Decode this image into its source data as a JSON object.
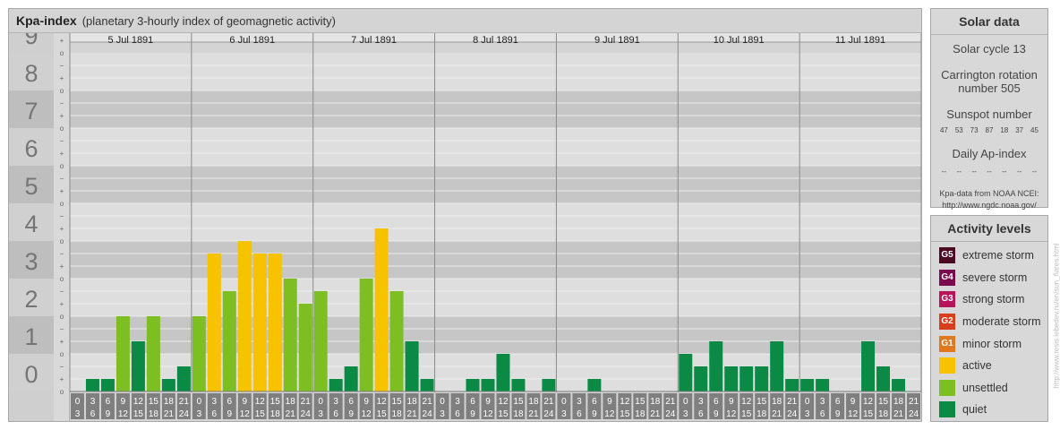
{
  "title": {
    "main": "Kpa-index",
    "subtitle": "(planetary 3-hourly index of geomagnetic activity)"
  },
  "chart_data": {
    "type": "bar",
    "title": "Kpa-index",
    "subtitle": "(planetary 3-hourly index of geomagnetic activity)",
    "ylim": [
      0,
      9
    ],
    "y_ticks": [
      "0",
      "1",
      "2",
      "3",
      "4",
      "5",
      "6",
      "7",
      "8",
      "9"
    ],
    "sub_ticks": [
      "+",
      "o",
      "−"
    ],
    "days": [
      "5 Jul 1891",
      "6 Jul 1891",
      "7 Jul 1891",
      "8 Jul 1891",
      "9 Jul 1891",
      "10 Jul 1891",
      "11 Jul 1891"
    ],
    "interval_starts": [
      "0",
      "3",
      "6",
      "9",
      "12",
      "15",
      "18",
      "21"
    ],
    "interval_ends": [
      "3",
      "6",
      "9",
      "12",
      "15",
      "18",
      "21",
      "24"
    ],
    "values": [
      [
        0,
        0.333,
        0.333,
        2,
        1.333,
        2,
        0.333,
        0.667
      ],
      [
        2,
        3.667,
        2.667,
        4,
        3.667,
        3.667,
        3,
        2.333
      ],
      [
        2.667,
        0.333,
        0.667,
        3,
        4.333,
        2.667,
        1.333,
        0.333
      ],
      [
        0,
        0,
        0.333,
        0.333,
        1,
        0.333,
        0,
        0.333
      ],
      [
        0,
        0,
        0.333,
        0,
        0,
        0,
        0,
        0
      ],
      [
        1,
        0.667,
        1.333,
        0.667,
        0.667,
        0.667,
        1.333,
        0.333
      ],
      [
        0.333,
        0.333,
        0,
        0,
        1.333,
        0.667,
        0.333,
        0
      ]
    ],
    "bar_colors": [
      [
        "quiet",
        "quiet",
        "quiet",
        "unsettled",
        "quiet",
        "unsettled",
        "quiet",
        "quiet"
      ],
      [
        "unsettled",
        "active",
        "unsettled",
        "active",
        "active",
        "active",
        "unsettled",
        "unsettled"
      ],
      [
        "unsettled",
        "quiet",
        "quiet",
        "unsettled",
        "active",
        "unsettled",
        "quiet",
        "quiet"
      ],
      [
        "quiet",
        "quiet",
        "quiet",
        "quiet",
        "quiet",
        "quiet",
        "quiet",
        "quiet"
      ],
      [
        "quiet",
        "quiet",
        "quiet",
        "quiet",
        "quiet",
        "quiet",
        "quiet",
        "quiet"
      ],
      [
        "quiet",
        "quiet",
        "quiet",
        "quiet",
        "quiet",
        "quiet",
        "quiet",
        "quiet"
      ],
      [
        "quiet",
        "quiet",
        "quiet",
        "quiet",
        "quiet",
        "quiet",
        "quiet",
        "quiet"
      ]
    ],
    "colors": {
      "quiet": "#0a8a45",
      "unsettled": "#7dbf23",
      "active": "#f7c200"
    }
  },
  "solar": {
    "heading": "Solar data",
    "cycle": "Solar cycle 13",
    "carrington_1": "Carrington rotation",
    "carrington_2": "number 505",
    "sunspot_label": "Sunspot number",
    "sunspots": [
      "47",
      "53",
      "73",
      "87",
      "18",
      "37",
      "45"
    ],
    "ap_label": "Daily Ap-index",
    "ap_values": [
      "--",
      "--",
      "--",
      "--",
      "--",
      "--",
      "--"
    ],
    "source_1": "Kpa-data from NOAA NCEI:",
    "source_2": "http://www.ngdc.noaa.gov/"
  },
  "activity": {
    "heading": "Activity levels",
    "levels": [
      {
        "code": "G5",
        "label": "extreme storm",
        "color": "#4a0a22"
      },
      {
        "code": "G4",
        "label": "severe storm",
        "color": "#7a0c4e"
      },
      {
        "code": "G3",
        "label": "strong storm",
        "color": "#b8145c"
      },
      {
        "code": "G2",
        "label": "moderate storm",
        "color": "#d83d1e"
      },
      {
        "code": "G1",
        "label": "minor storm",
        "color": "#e07820"
      },
      {
        "code": "",
        "label": "active",
        "color": "#f7c200"
      },
      {
        "code": "",
        "label": "unsettled",
        "color": "#7dbf23"
      },
      {
        "code": "",
        "label": "quiet",
        "color": "#0a8a45"
      }
    ]
  },
  "watermark": "http://www.tesis.lebedev.ru/en/sun_flares.html"
}
